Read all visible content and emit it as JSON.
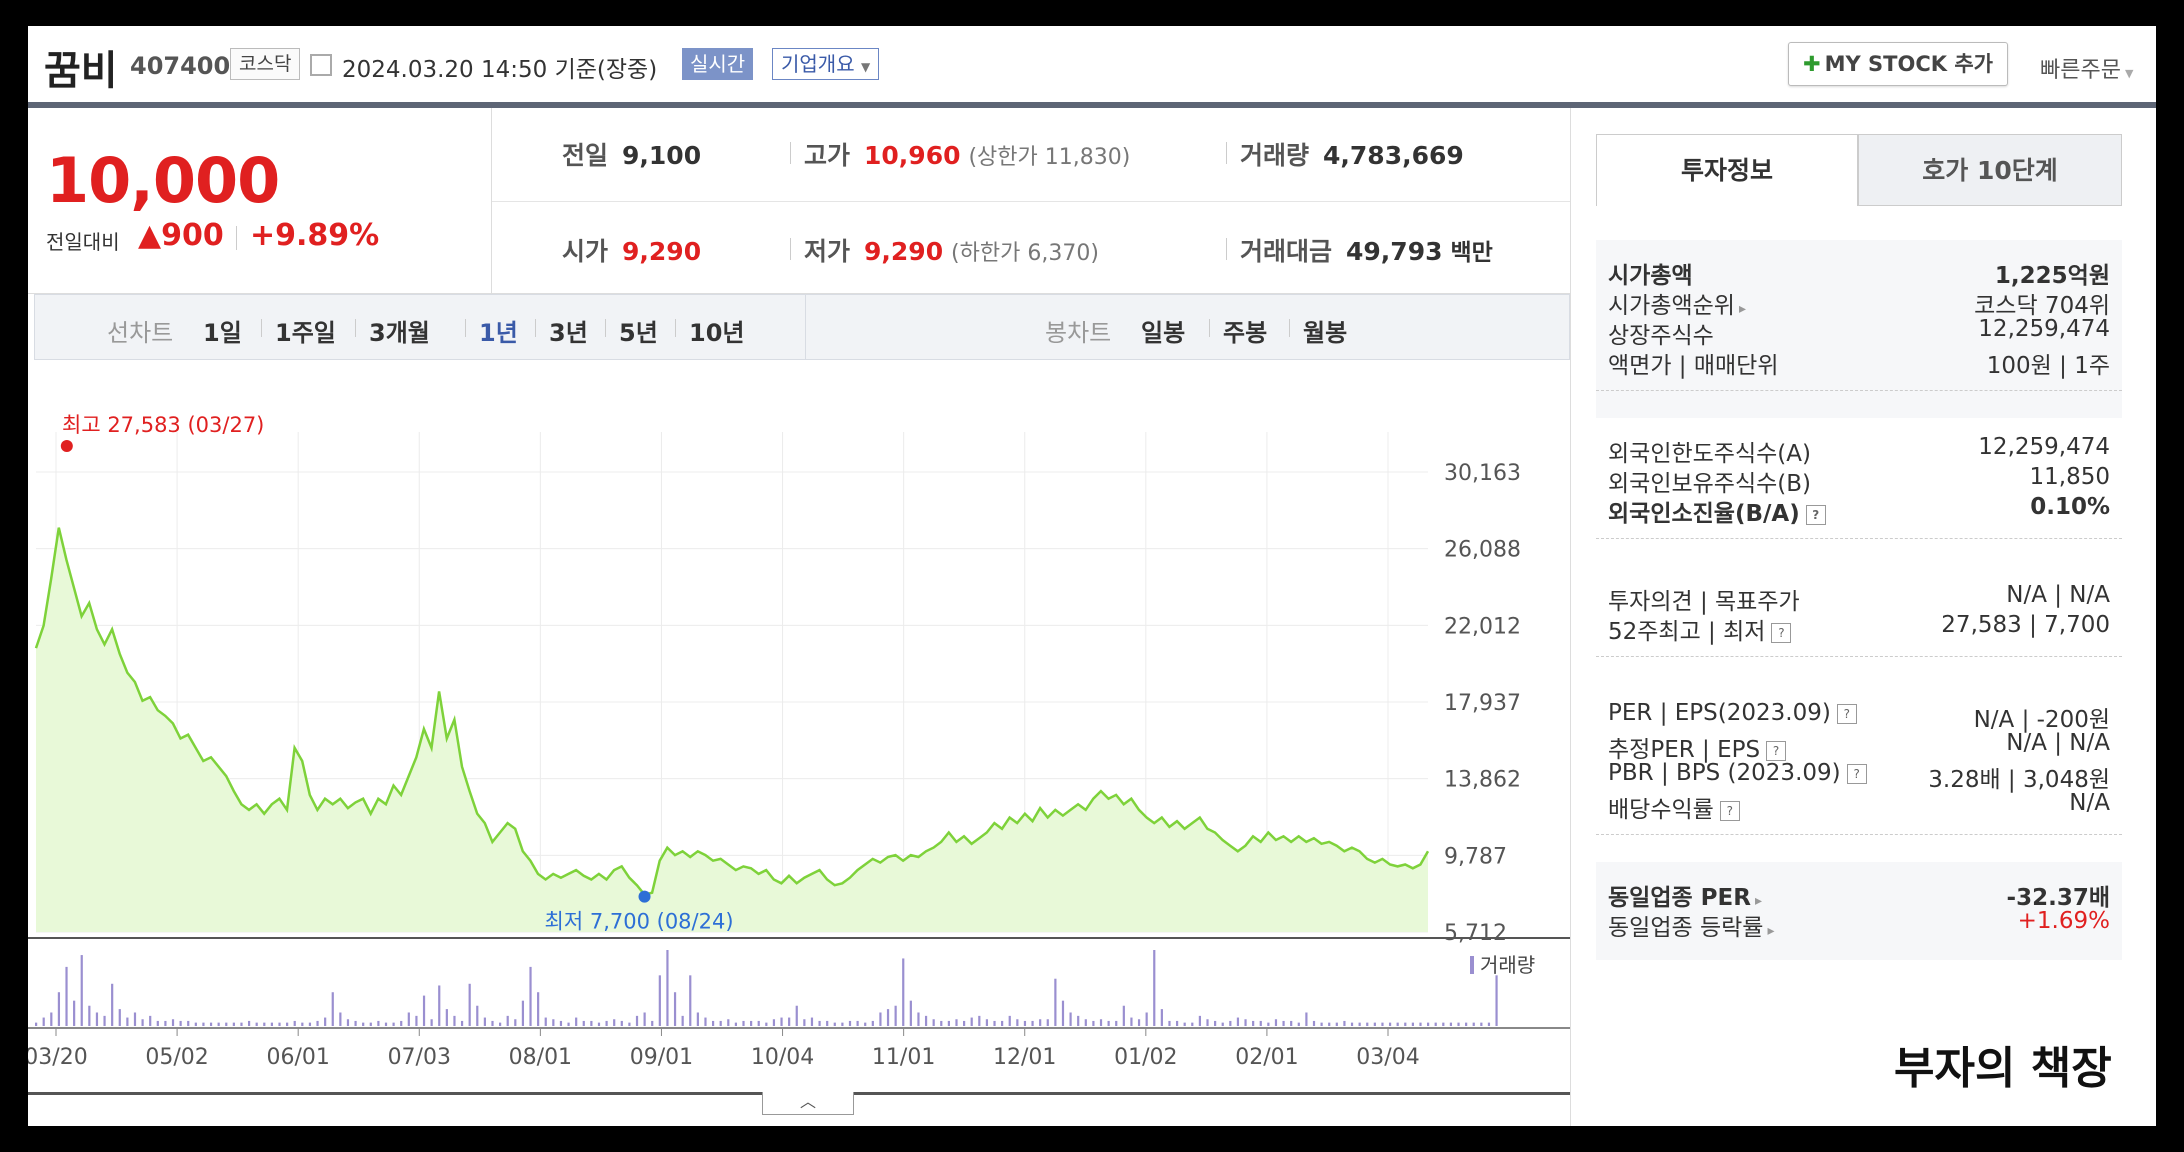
{
  "header": {
    "stock_name": "꿈비",
    "stock_code": "407400",
    "market": "코스닥",
    "datetime": "2024.03.20 14:50 기준(장중)",
    "realtime_badge": "실시간",
    "company_overview": "기업개요",
    "my_stock_button": "MY STOCK 추가",
    "quick_order": "빠른주문"
  },
  "price": {
    "current": "10,000",
    "change_label": "전일대비",
    "change_value": "▲900",
    "change_pct": "+9.89%"
  },
  "summary": {
    "prev_close_label": "전일",
    "prev_close": "9,100",
    "high_label": "고가",
    "high": "10,960",
    "upper_limit": "(상한가 11,830)",
    "volume_label": "거래량",
    "volume": "4,783,669",
    "open_label": "시가",
    "open": "9,290",
    "low_label": "저가",
    "low": "9,290",
    "lower_limit": "(하한가 6,370)",
    "amount_label": "거래대금",
    "amount": "49,793",
    "amount_unit": "백만"
  },
  "controls": {
    "line_chart_label": "선차트",
    "periods": [
      "1일",
      "1주일",
      "3개월",
      "1년",
      "3년",
      "5년",
      "10년"
    ],
    "selected_period": "1년",
    "candle_chart_label": "봉차트",
    "candle_periods": [
      "일봉",
      "주봉",
      "월봉"
    ]
  },
  "chart_data": {
    "type": "area",
    "x_tick_labels": [
      "03/20",
      "05/02",
      "06/01",
      "07/03",
      "08/01",
      "09/01",
      "10/04",
      "11/01",
      "12/01",
      "01/02",
      "02/01",
      "03/04"
    ],
    "y_tick_labels": [
      "30,163",
      "26,088",
      "22,012",
      "17,937",
      "13,862",
      "9,787",
      "5,712"
    ],
    "ylim": [
      5712,
      30163
    ],
    "grid": true,
    "max_annotation": "최고 27,583 (03/27)",
    "min_annotation": "최저 7,700 (08/24)",
    "volume_legend": "거래량",
    "series": [
      {
        "values": [
          20800,
          22000,
          24500,
          27200,
          25500,
          24000,
          22500,
          23200,
          21800,
          21000,
          21800,
          20500,
          19500,
          19000,
          18000,
          18200,
          17500,
          17200,
          16800,
          16000,
          16200,
          15500,
          14800,
          15000,
          14500,
          14000,
          13200,
          12500,
          12200,
          12500,
          12000,
          12500,
          12800,
          12200,
          15500,
          14800,
          13000,
          12200,
          12800,
          12500,
          12800,
          12300,
          12600,
          12800,
          12000,
          12800,
          12500,
          13500,
          13000,
          14000,
          15000,
          16500,
          15500,
          18500,
          16000,
          17000,
          14500,
          13200,
          12000,
          11500,
          10500,
          11000,
          11500,
          11200,
          10000,
          9500,
          8800,
          8500,
          8800,
          8600,
          8800,
          9000,
          8700,
          8500,
          8800,
          8500,
          9000,
          9200,
          8600,
          8200,
          7700,
          7800,
          9500,
          10200,
          9800,
          10000,
          9700,
          10000,
          9800,
          9500,
          9600,
          9300,
          9000,
          9200,
          9100,
          8800,
          9000,
          8500,
          8300,
          8700,
          8300,
          8600,
          8800,
          9000,
          8500,
          8200,
          8300,
          8600,
          9000,
          9300,
          9600,
          9400,
          9700,
          9800,
          9500,
          9800,
          9700,
          10000,
          10200,
          10500,
          11000,
          10500,
          10800,
          10400,
          10700,
          11000,
          11500,
          11200,
          11800,
          11500,
          12000,
          11600,
          12300,
          11800,
          12200,
          11900,
          12200,
          12500,
          12200,
          12800,
          13200,
          12800,
          13000,
          12500,
          12800,
          12200,
          11800,
          11500,
          11800,
          11300,
          11600,
          11200,
          11500,
          11800,
          11200,
          11000,
          10600,
          10300,
          10000,
          10300,
          10800,
          10500,
          11000,
          10600,
          10800,
          10500,
          10800,
          10500,
          10700,
          10400,
          10500,
          10300,
          10000,
          10200,
          10000,
          9600,
          9400,
          9600,
          9300,
          9200,
          9300,
          9100,
          9300,
          10000
        ]
      },
      {
        "name": "거래량",
        "values": [
          2,
          5,
          8,
          20,
          35,
          15,
          42,
          12,
          8,
          6,
          25,
          10,
          5,
          8,
          4,
          6,
          3,
          3,
          4,
          3,
          3,
          2,
          2,
          2,
          2,
          2,
          2,
          2,
          3,
          2,
          2,
          2,
          2,
          2,
          3,
          2,
          2,
          3,
          5,
          20,
          8,
          4,
          3,
          2,
          2,
          3,
          2,
          2,
          3,
          8,
          6,
          18,
          4,
          24,
          10,
          6,
          3,
          25,
          12,
          5,
          3,
          2,
          6,
          4,
          15,
          35,
          20,
          5,
          4,
          3,
          2,
          5,
          3,
          3,
          2,
          3,
          4,
          3,
          2,
          6,
          8,
          3,
          30,
          45,
          20,
          6,
          30,
          8,
          5,
          3,
          3,
          4,
          2,
          3,
          3,
          3,
          2,
          4,
          5,
          5,
          12,
          4,
          5,
          3,
          3,
          2,
          2,
          3,
          3,
          2,
          3,
          8,
          10,
          12,
          40,
          15,
          8,
          6,
          4,
          3,
          3,
          4,
          3,
          5,
          6,
          4,
          3,
          3,
          6,
          4,
          3,
          3,
          4,
          4,
          28,
          15,
          8,
          6,
          4,
          3,
          4,
          3,
          3,
          12,
          5,
          4,
          8,
          45,
          10,
          3,
          3,
          2,
          2,
          6,
          4,
          3,
          2,
          3,
          5,
          4,
          3,
          3,
          2,
          4,
          3,
          3,
          2,
          8,
          3,
          2,
          2,
          2,
          3,
          2,
          2,
          2,
          2,
          2,
          2,
          2,
          2,
          2,
          2,
          2,
          2,
          2,
          2,
          2,
          2,
          2,
          2,
          2,
          30
        ]
      }
    ]
  },
  "info_panel": {
    "tabs": [
      "투자정보",
      "호가 10단계"
    ],
    "groups": [
      [
        {
          "key": "시가총액",
          "value": "1,225억원",
          "bold": true
        },
        {
          "key": "시가총액순위",
          "value": "코스닥 704위",
          "arrow": true
        },
        {
          "key": "상장주식수",
          "value": "12,259,474"
        },
        {
          "key": "액면가 | 매매단위",
          "value": "100원 | 1주"
        }
      ],
      [
        {
          "key": "외국인한도주식수(A)",
          "value": "12,259,474"
        },
        {
          "key": "외국인보유주식수(B)",
          "value": "11,850"
        },
        {
          "key": "외국인소진율(B/A)",
          "value": "0.10%",
          "bold": true,
          "help": true
        }
      ],
      [
        {
          "key": "투자의견 | 목표주가",
          "value": "N/A | N/A"
        },
        {
          "key": "52주최고 | 최저",
          "value": "27,583 | 7,700",
          "help": true
        }
      ],
      [
        {
          "key": "PER | EPS(2023.09)",
          "value": "N/A | -200원",
          "help": true
        },
        {
          "key": "추정PER | EPS",
          "value": "N/A | N/A",
          "help": true
        },
        {
          "key": "PBR | BPS (2023.09)",
          "value": "3.28배 | 3,048원",
          "help": true
        },
        {
          "key": "배당수익률",
          "value": "N/A",
          "help": true
        }
      ],
      [
        {
          "key": "동일업종 PER",
          "value": "-32.37배",
          "bold": true,
          "arrow": true
        },
        {
          "key": "동일업종 등락률",
          "value": "+1.69%",
          "red": true,
          "arrow": true
        }
      ]
    ]
  },
  "watermark": "부자의 책장",
  "colors": {
    "up": "#e02020",
    "line": "#7ed23a",
    "fill": "#e8f9d8",
    "volume": "#9a8fd0",
    "min_dot": "#2d6fd6"
  }
}
